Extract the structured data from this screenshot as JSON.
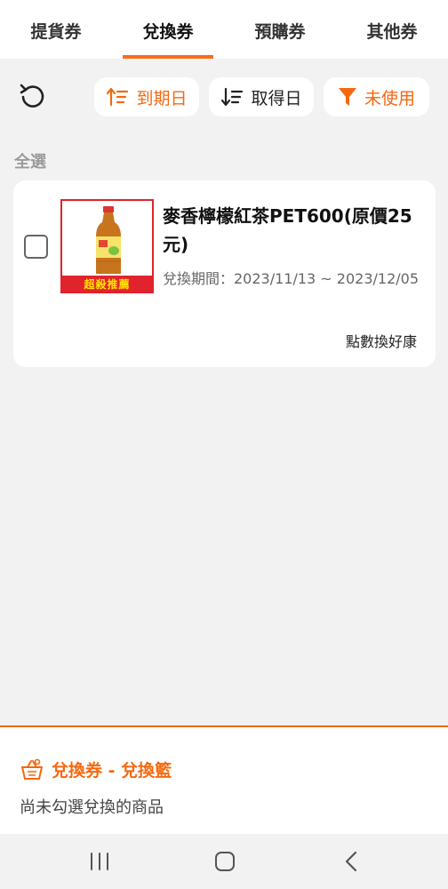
{
  "tabs": [
    {
      "label": "提貨券",
      "active": false
    },
    {
      "label": "兌換券",
      "active": true
    },
    {
      "label": "預購券",
      "active": false
    },
    {
      "label": "其他券",
      "active": false
    }
  ],
  "toolbar": {
    "sort_expire_label": "到期日",
    "sort_obtain_label": "取得日",
    "filter_label": "未使用"
  },
  "select_all_label": "全選",
  "coupons": [
    {
      "name": "麥香檸檬紅茶PET600(原價25元)",
      "badge": "超殺推薦",
      "period": "兌換期間：2023/11/13 ~ 2023/12/05",
      "source": "點數換好康",
      "checked": false
    }
  ],
  "basket": {
    "title": "兌換券 - 兌換籃",
    "hint": "尚未勾選兌換的商品"
  },
  "colors": {
    "accent": "#f5680f",
    "badge_red": "#e0232c",
    "badge_text": "#ffe600"
  }
}
